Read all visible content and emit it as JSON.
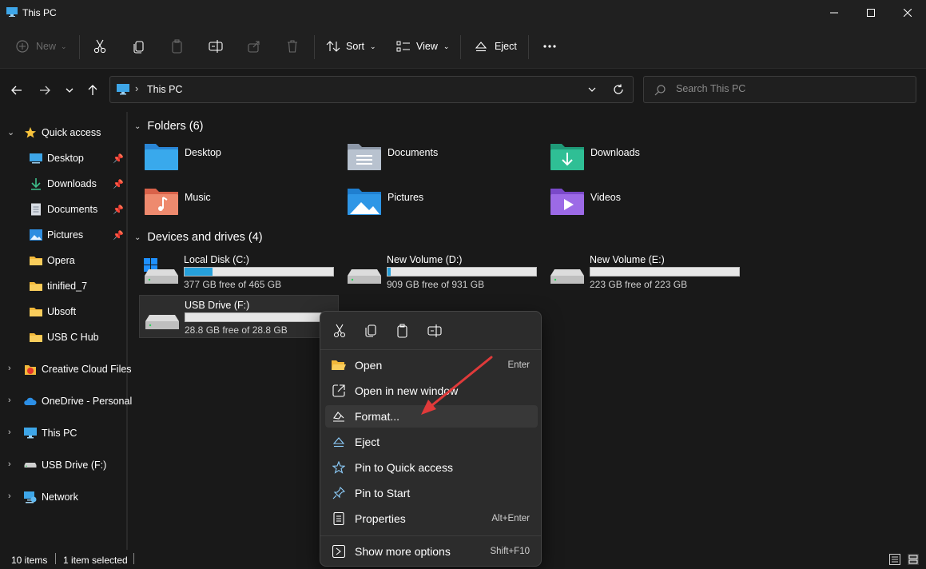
{
  "window": {
    "title": "This PC"
  },
  "toolbar": {
    "new_label": "New",
    "sort_label": "Sort",
    "view_label": "View",
    "eject_label": "Eject"
  },
  "address": {
    "location": "This PC"
  },
  "search": {
    "placeholder": "Search This PC"
  },
  "sidebar": {
    "quick_access": "Quick access",
    "items": [
      {
        "label": "Desktop",
        "icon": "desktop-icon",
        "pinned": true
      },
      {
        "label": "Downloads",
        "icon": "download-icon",
        "pinned": true
      },
      {
        "label": "Documents",
        "icon": "document-icon",
        "pinned": true
      },
      {
        "label": "Pictures",
        "icon": "picture-icon",
        "pinned": true
      },
      {
        "label": "Opera",
        "icon": "folder-icon",
        "pinned": false
      },
      {
        "label": "tinified_7",
        "icon": "folder-icon",
        "pinned": false
      },
      {
        "label": "Ubsoft",
        "icon": "folder-icon",
        "pinned": false
      },
      {
        "label": "USB C Hub",
        "icon": "folder-icon",
        "pinned": false
      }
    ],
    "roots": [
      {
        "label": "Creative Cloud Files",
        "icon": "creative-cloud-icon"
      },
      {
        "label": "OneDrive - Personal",
        "icon": "onedrive-icon"
      },
      {
        "label": "This PC",
        "icon": "pc-icon"
      },
      {
        "label": "USB Drive (F:)",
        "icon": "usb-drive-icon"
      },
      {
        "label": "Network",
        "icon": "network-icon"
      }
    ]
  },
  "content": {
    "folders_heading": "Folders (6)",
    "folders": [
      {
        "label": "Desktop",
        "icon": "desktop-folder-icon"
      },
      {
        "label": "Documents",
        "icon": "documents-folder-icon"
      },
      {
        "label": "Downloads",
        "icon": "downloads-folder-icon"
      },
      {
        "label": "Music",
        "icon": "music-folder-icon"
      },
      {
        "label": "Pictures",
        "icon": "pictures-folder-icon"
      },
      {
        "label": "Videos",
        "icon": "videos-folder-icon"
      }
    ],
    "drives_heading": "Devices and drives (4)",
    "drives": [
      {
        "name": "Local Disk (C:)",
        "free": "377 GB free of 465 GB",
        "used_fraction": 0.19,
        "selected": false
      },
      {
        "name": "New Volume (D:)",
        "free": "909 GB free of 931 GB",
        "used_fraction": 0.02,
        "selected": false
      },
      {
        "name": "New Volume (E:)",
        "free": "223 GB free of 223 GB",
        "used_fraction": 0.0,
        "selected": false
      },
      {
        "name": "USB Drive (F:)",
        "free": "28.8 GB free of 28.8 GB",
        "used_fraction": 0.0,
        "selected": true
      }
    ]
  },
  "context_menu": {
    "quick_actions": [
      "cut-icon",
      "copy-icon",
      "paste-icon",
      "rename-icon"
    ],
    "items": [
      {
        "label": "Open",
        "shortcut": "Enter",
        "icon": "open-folder-icon"
      },
      {
        "label": "Open in new window",
        "shortcut": "",
        "icon": "new-window-icon"
      },
      {
        "label": "Format...",
        "shortcut": "",
        "icon": "format-icon"
      },
      {
        "label": "Eject",
        "shortcut": "",
        "icon": "eject-icon"
      },
      {
        "label": "Pin to Quick access",
        "shortcut": "",
        "icon": "star-icon"
      },
      {
        "label": "Pin to Start",
        "shortcut": "",
        "icon": "pin-icon"
      },
      {
        "label": "Properties",
        "shortcut": "Alt+Enter",
        "icon": "properties-icon"
      }
    ],
    "more": {
      "label": "Show more options",
      "shortcut": "Shift+F10",
      "icon": "more-options-icon"
    }
  },
  "status": {
    "item_count": "10 items",
    "selection": "1 item selected"
  },
  "colors": {
    "accent": "#26a0da",
    "background": "#191919",
    "chrome": "#202020",
    "menu": "#2c2c2c",
    "annotation_arrow": "#e03a3a"
  }
}
